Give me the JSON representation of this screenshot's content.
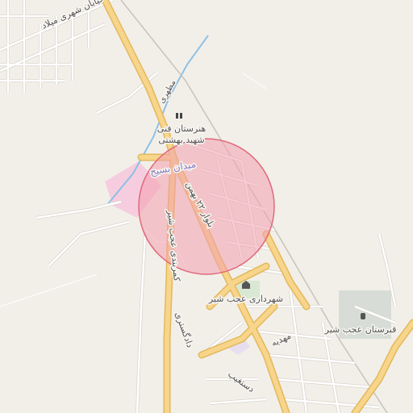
{
  "map": {
    "highlight": {
      "fill": "#f2a0ae",
      "stroke": "#e06a7c",
      "opacity": 0.55
    },
    "colors": {
      "land": "#f2efe9",
      "minor_road": "#ffffff",
      "minor_road_casing": "#d8d4cc",
      "major_road": "#f7d58a",
      "major_road_casing": "#e3b85c",
      "water": "#8ec0e6",
      "park": "#d9e8d2",
      "landuse_pink": "#f6c4dc",
      "cemetery": "#d7ddd6"
    },
    "labels": {
      "street_milad": "خیابان شهری میلاد",
      "street_motahari": "مطهری",
      "school": "هنرستان فنی",
      "school_line2": "شهید بهشتی",
      "square": "میدان بسیج",
      "boulevard": "بلوار ۲۲ بهمن",
      "ring_road": "کمربندی عجب شیر",
      "street_dadgostari": "دادگستری",
      "municipality": "شهرداری عجب شیر",
      "street_mahdieh": "مهدیه",
      "street_south": "دستغیب",
      "cemetery": "قبرستان عجب شیر"
    },
    "icons": {
      "school": "school-icon",
      "municipality": "town-hall-icon",
      "cemetery": "cemetery-icon"
    }
  }
}
